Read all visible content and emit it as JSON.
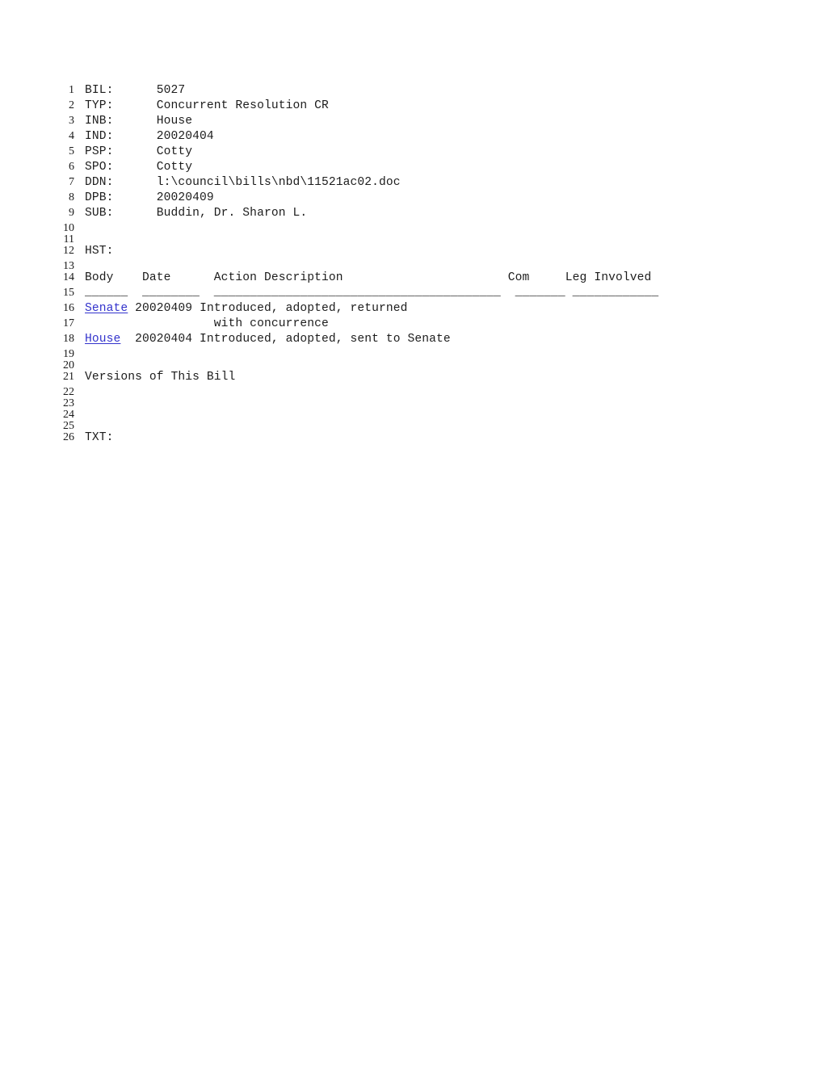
{
  "document": {
    "type": "legislative-bill-record",
    "fields": [
      {
        "label": "BIL:",
        "value": "5027"
      },
      {
        "label": "TYP:",
        "value": "Concurrent Resolution CR"
      },
      {
        "label": "INB:",
        "value": "House"
      },
      {
        "label": "IND:",
        "value": "20020404"
      },
      {
        "label": "PSP:",
        "value": "Cotty"
      },
      {
        "label": "SPO:",
        "value": "Cotty"
      },
      {
        "label": "DDN:",
        "value": "l:\\council\\bills\\nbd\\11521ac02.doc"
      },
      {
        "label": "DPB:",
        "value": "20020409"
      },
      {
        "label": "SUB:",
        "value": "Buddin, Dr. Sharon L."
      }
    ],
    "history_label": "HST:",
    "text_label": "TXT:",
    "versions_label": "Versions of This Bill"
  },
  "history_table": {
    "headers": {
      "body": "Body",
      "date": "Date",
      "action": "Action Description",
      "com": "Com",
      "leg": "Leg Involved"
    },
    "separators": {
      "body": "______",
      "date": "________",
      "action": "________________________________________",
      "com": "_______",
      "leg": "____________"
    },
    "rows": [
      {
        "body": "Senate",
        "body_is_link": true,
        "date": "20020409",
        "action": "Introduced, adopted, returned",
        "action_cont": "with concurrence",
        "com": "",
        "leg": ""
      },
      {
        "body": "House",
        "body_is_link": true,
        "date": "20020404",
        "action": "Introduced, adopted, sent to Senate",
        "action_cont": "",
        "com": "",
        "leg": ""
      }
    ]
  },
  "line_numbers": {
    "n1": "1",
    "n2": "2",
    "n3": "3",
    "n4": "4",
    "n5": "5",
    "n6": "6",
    "n7": "7",
    "n8": "8",
    "n9": "9",
    "n10": "10",
    "n11": "11",
    "n12": "12",
    "n13": "13",
    "n14": "14",
    "n15": "15",
    "n16": "16",
    "n17": "17",
    "n18": "18",
    "n19": "19",
    "n20": "20",
    "n21": "21",
    "n22": "22",
    "n23": "23",
    "n24": "24",
    "n25": "25",
    "n26": "26"
  },
  "lines": {
    "l1": "BIL:      5027",
    "l2": "TYP:      Concurrent Resolution CR",
    "l3": "INB:      House",
    "l4": "IND:      20020404",
    "l5": "PSP:      Cotty",
    "l6": "SPO:      Cotty",
    "l7": "DDN:      l:\\council\\bills\\nbd\\11521ac02.doc",
    "l8": "DPB:      20020409",
    "l9": "SUB:      Buddin, Dr. Sharon L.",
    "l10": "",
    "l11": "",
    "l12": "HST:",
    "l13": "",
    "l14": "Body    Date      Action Description                       Com     Leg Involved",
    "l15": "______  ________  ________________________________________  _______ ____________",
    "l16_date": " 20020409 ",
    "l16_action": "Introduced, adopted, returned",
    "l17": "                  with concurrence",
    "l18_date": "  20020404 ",
    "l18_action": "Introduced, adopted, sent to Senate",
    "l19": "",
    "l20": "",
    "l21": "Versions of This Bill",
    "l22": "",
    "l23": "",
    "l24": "",
    "l25": "",
    "l26": "TXT:"
  },
  "colors": {
    "link": "#3333cc",
    "text": "#1c1c1c",
    "background": "#ffffff"
  }
}
